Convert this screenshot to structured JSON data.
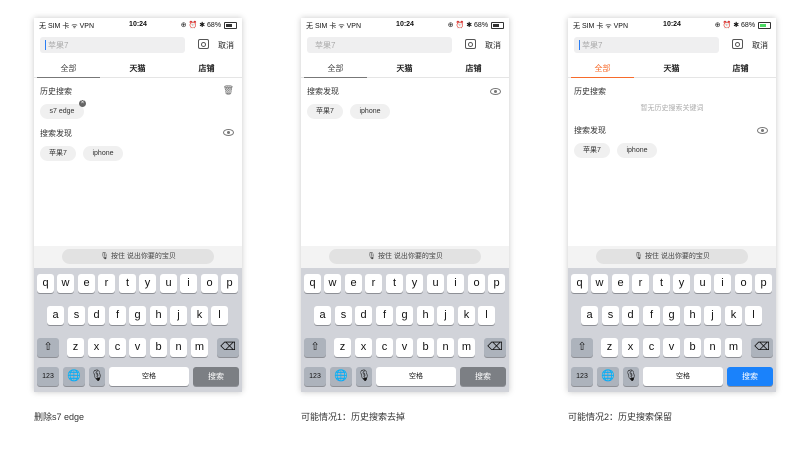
{
  "status": {
    "left": "无 SIM 卡 ᯤ VPN",
    "time": "10:24",
    "right": "⊕ ⏰ ✱ 68%"
  },
  "search": {
    "placeholder": "苹果7",
    "cancel": "取消"
  },
  "tabs": [
    "全部",
    "天猫",
    "店铺"
  ],
  "sections": {
    "history": "历史搜索",
    "discover": "搜索发现",
    "history_empty": "暂无历史搜索关键词",
    "history_chip": "s7 edge"
  },
  "discover_chips": [
    "苹果7",
    "iphone"
  ],
  "voice": {
    "label": "按住  说出你要的宝贝"
  },
  "keyboard": {
    "row1": [
      "q",
      "w",
      "e",
      "r",
      "t",
      "y",
      "u",
      "i",
      "o",
      "p"
    ],
    "row2": [
      "a",
      "s",
      "d",
      "f",
      "g",
      "h",
      "j",
      "k",
      "l"
    ],
    "row3": [
      "z",
      "x",
      "c",
      "v",
      "b",
      "n",
      "m"
    ],
    "num": "123",
    "space": "空格",
    "search": "搜索"
  },
  "captions": [
    "删除s7 edge",
    "可能情况1：历史搜索去掉",
    "可能情况2：历史搜索保留"
  ]
}
